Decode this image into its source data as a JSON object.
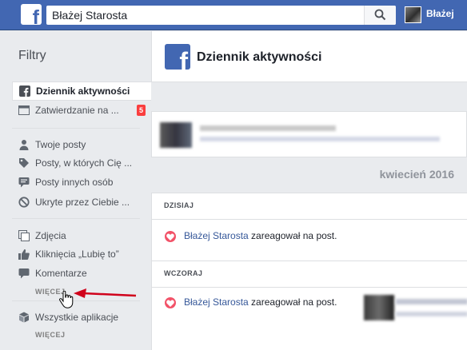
{
  "topbar": {
    "search_value": "Błażej Starosta",
    "user_name": "Błażej",
    "logo_glyph": "f",
    "brand_color": "#4267b2"
  },
  "sidebar": {
    "title": "Filtry",
    "items": [
      {
        "label": "Dziennik aktywności",
        "icon": "facebook-logo-icon",
        "active": true
      },
      {
        "label": "Zatwierdzanie na ...",
        "icon": "timeline-review-icon",
        "badge": "5"
      },
      {
        "label": "Twoje posty",
        "icon": "person-icon"
      },
      {
        "label": "Posty, w których Cię ...",
        "icon": "tag-icon"
      },
      {
        "label": "Posty innych osób",
        "icon": "chat-bubble-icon"
      },
      {
        "label": "Ukryte przez Ciebie ...",
        "icon": "hidden-icon"
      },
      {
        "label": "Zdjęcia",
        "icon": "photos-icon"
      },
      {
        "label": "Kliknięcia „Lubię to”",
        "icon": "thumbs-up-icon"
      },
      {
        "label": "Komentarze",
        "icon": "comment-icon"
      },
      {
        "label": "Wszystkie aplikacje",
        "icon": "apps-cube-icon"
      }
    ],
    "more_labels": [
      "WIĘCEJ",
      "WIĘCEJ"
    ],
    "badge_color": "#fa3e3e"
  },
  "main": {
    "panel_title": "Dziennik aktywności",
    "month_label": "kwiecień 2016",
    "days": [
      {
        "label": "DZISIAJ",
        "entry": {
          "actor": "Błażej Starosta",
          "action": " zareagował na post."
        }
      },
      {
        "label": "WCZORAJ",
        "entry": {
          "actor": "Błażej Starosta",
          "action": " zareagował na post."
        }
      }
    ],
    "link_color": "#365899",
    "reaction_color": "#f25268"
  },
  "annotation": {
    "arrow_color": "#d0021b"
  }
}
